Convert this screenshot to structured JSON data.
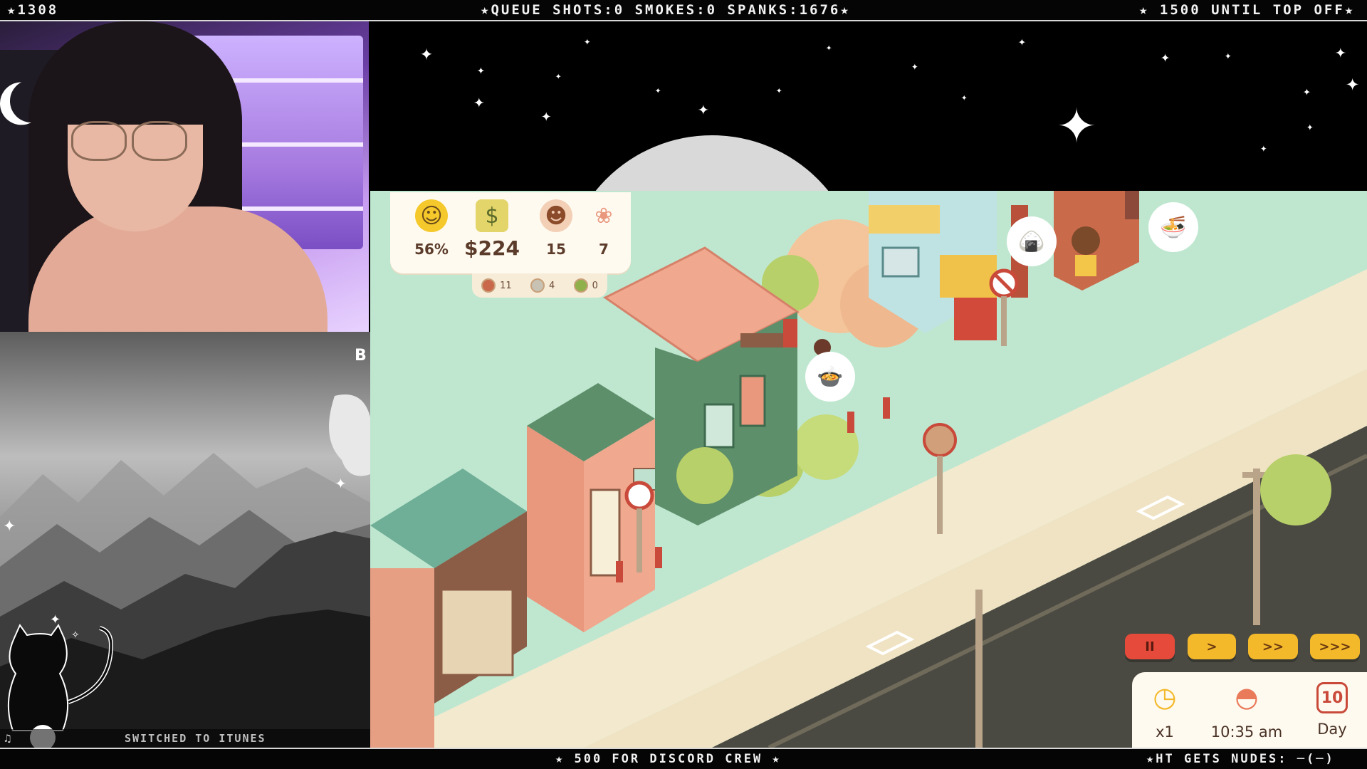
{
  "ticker_top": {
    "left": "★1308",
    "center": "★QUEUE SHOTS:0 SMOKES:0 SPANKS:1676★",
    "right": "★ 1500 UNTIL TOP OFF★"
  },
  "ticker_bottom": {
    "center": "★ 500 FOR DISCORD CREW ★",
    "right": "★HT GETS NUDES: ─(─)"
  },
  "status_bar": {
    "icon": "music-note-icon",
    "text": "SWITCHED TO ITUNES"
  },
  "hud": {
    "happiness": "56%",
    "money": "$224",
    "customers": "15",
    "tulips": "7",
    "sub_stats": [
      "11",
      "4",
      "0"
    ]
  },
  "speed_controls": {
    "pause": "II",
    "play": ">",
    "fast": ">>",
    "faster": ">>>"
  },
  "time_panel": {
    "multiplier": "x1",
    "clock": "10:35 am",
    "day_label": "Day",
    "day_number": "10"
  },
  "colors": {
    "grass": "#bfe7d0",
    "road": "#4a4a42",
    "sidewalk": "#efe3c3",
    "speed_red": "#e64a3a",
    "speed_yellow": "#f4b92b"
  }
}
